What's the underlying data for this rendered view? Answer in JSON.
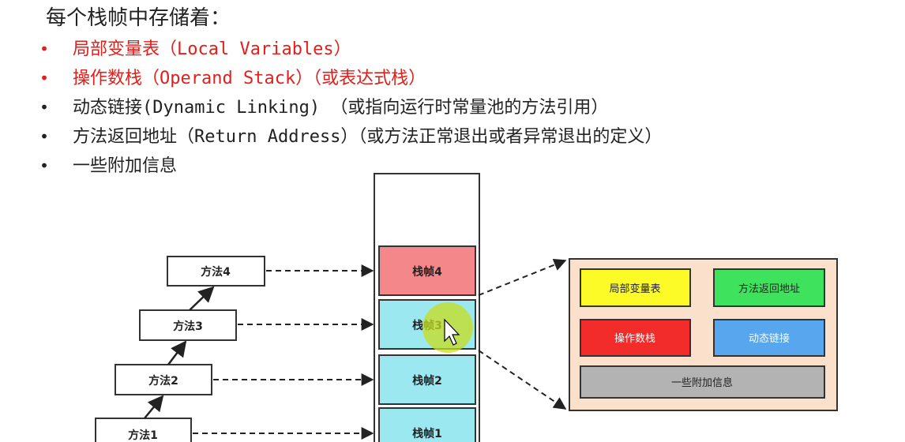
{
  "heading": "每个栈帧中存储着：",
  "bullets": [
    {
      "text": "局部变量表（Local Variables）",
      "color": "#e0201c"
    },
    {
      "text": "操作数栈（Operand Stack）（或表达式栈）",
      "color": "#e0201c"
    },
    {
      "text": "动态链接(Dynamic Linking) （或指向运行时常量池的方法引用）",
      "color": "#222222"
    },
    {
      "text": "方法返回地址（Return Address）（或方法正常退出或者异常退出的定义）",
      "color": "#222222"
    },
    {
      "text": "一些附加信息",
      "color": "#222222"
    }
  ],
  "bullet_symbol": "•",
  "methods": [
    "方法4",
    "方法3",
    "方法2",
    "方法1"
  ],
  "frames": [
    {
      "label": "栈帧4",
      "color": "#f4878a"
    },
    {
      "label": "栈帧3",
      "color": "#9be8f0"
    },
    {
      "label": "栈帧2",
      "color": "#9be8f0"
    },
    {
      "label": "栈帧1",
      "color": "#9be8f0"
    }
  ],
  "detail_box": {
    "background": "#fbe0cc",
    "items": [
      {
        "label": "局部变量表",
        "color": "#fcfb28"
      },
      {
        "label": "方法返回地址",
        "color": "#3fe25d"
      },
      {
        "label": "操作数栈",
        "color": "#f22b2b"
      },
      {
        "label": "动态链接",
        "color": "#57a6ee"
      },
      {
        "label": "一些附加信息",
        "color": "#b3b3b3"
      }
    ]
  }
}
